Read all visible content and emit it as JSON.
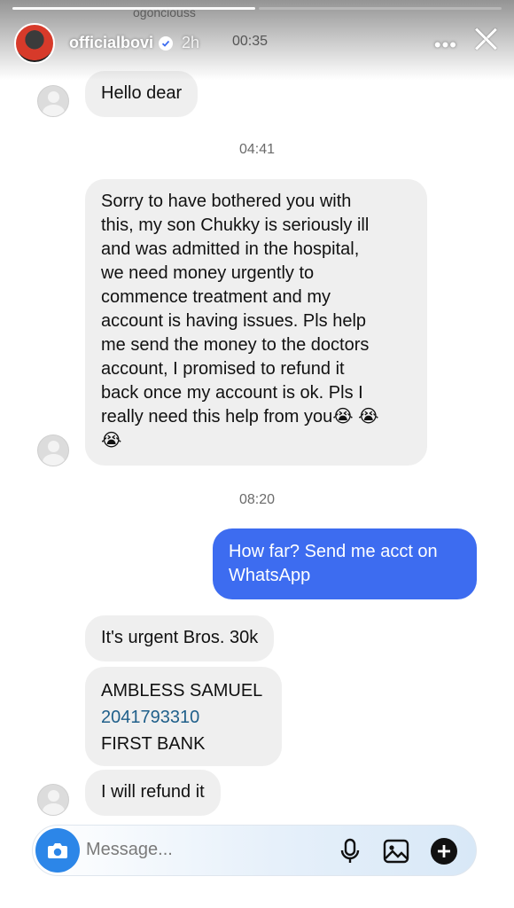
{
  "story": {
    "username": "officialbovi",
    "age": "2h",
    "clip_time": "00:35",
    "behind_text": "ogonciouss"
  },
  "chat": {
    "messages": [
      {
        "type": "timestamp",
        "text": "04:41"
      },
      {
        "type": "timestamp",
        "text": "08:20"
      }
    ],
    "bubble1": "Hello dear",
    "bubble2_lines": [
      "Sorry to have bothered you with",
      "this, my son Chukky is seriously ill",
      "and was admitted in the hospital,",
      "we need money urgently to",
      "commence treatment and my",
      "account is having issues. Pls help",
      "me send the money to the doctors",
      "account, I promised to refund it",
      "back once my account is ok. Pls I",
      "really need this help from you😭 😭",
      "😭"
    ],
    "sent_lines": [
      "How far? Send me acct on",
      "WhatsApp"
    ],
    "bubble4": "It's urgent Bros. 30k",
    "bank_name": "AMBLESS SAMUEL",
    "bank_account": "2041793310",
    "bank": "FIRST BANK",
    "bubble6": "I will refund it"
  },
  "composer": {
    "placeholder": "Message..."
  },
  "icons": {
    "camera": "camera-icon",
    "mic": "microphone-icon",
    "gallery": "image-icon",
    "plus": "plus-circle-icon"
  },
  "colors": {
    "sent_bubble": "#3d6cf0",
    "received_bubble": "#efefef",
    "camera": "#2c86e8"
  }
}
